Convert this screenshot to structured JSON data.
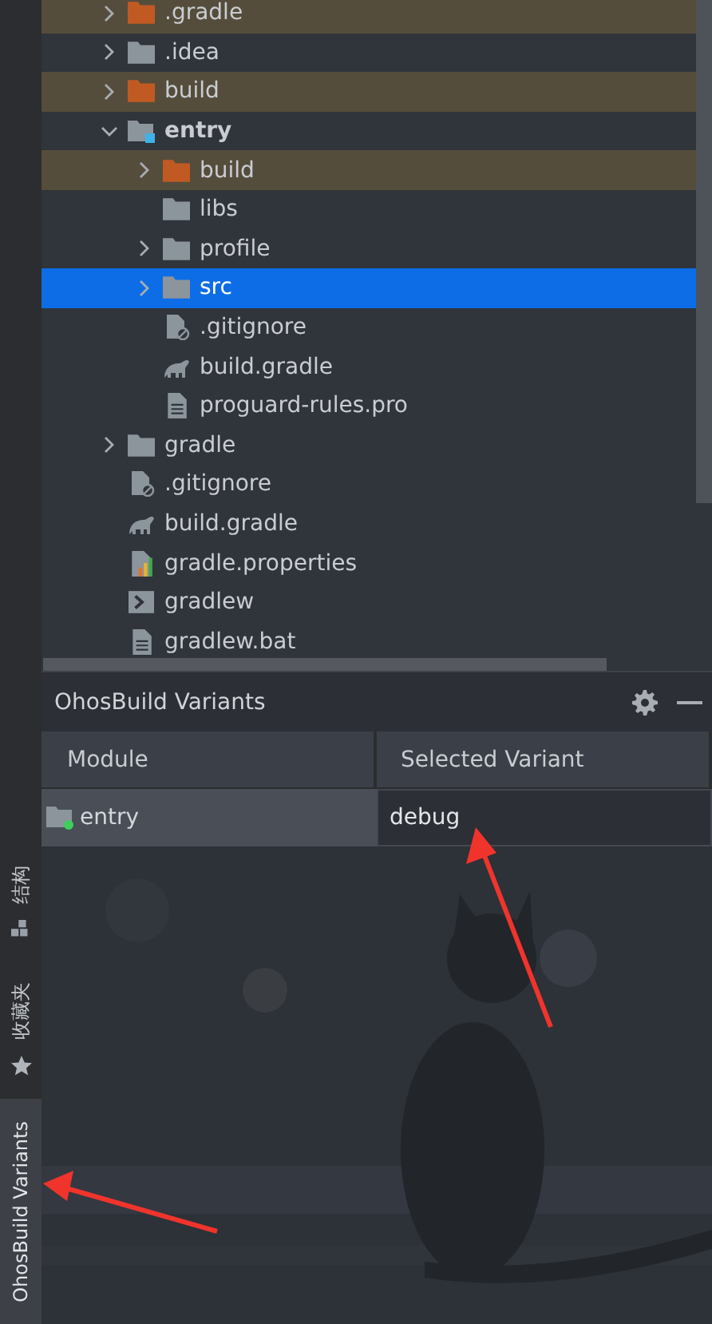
{
  "project_tree": {
    "items": [
      {
        "label": ".gradle",
        "kind": "folder",
        "excluded": true,
        "expanded": false,
        "selected": false
      },
      {
        "label": ".idea",
        "kind": "folder",
        "excluded": false,
        "expanded": false,
        "selected": false
      },
      {
        "label": "build",
        "kind": "folder",
        "excluded": true,
        "expanded": false,
        "selected": false
      },
      {
        "label": "entry",
        "kind": "module",
        "excluded": false,
        "expanded": true,
        "selected": false,
        "children": [
          {
            "label": "build",
            "kind": "folder",
            "excluded": true,
            "expanded": false,
            "selected": false
          },
          {
            "label": "libs",
            "kind": "folder",
            "excluded": false,
            "selected": false
          },
          {
            "label": "profile",
            "kind": "folder",
            "excluded": false,
            "expanded": false,
            "selected": false
          },
          {
            "label": "src",
            "kind": "folder",
            "excluded": false,
            "expanded": false,
            "selected": true
          },
          {
            "label": ".gitignore",
            "kind": "ignore",
            "excluded": false,
            "selected": false
          },
          {
            "label": "build.gradle",
            "kind": "gradle",
            "excluded": false,
            "selected": false
          },
          {
            "label": "proguard-rules.pro",
            "kind": "text",
            "excluded": false,
            "selected": false
          }
        ]
      },
      {
        "label": "gradle",
        "kind": "folder",
        "excluded": false,
        "expanded": false,
        "selected": false
      },
      {
        "label": ".gitignore",
        "kind": "ignore",
        "excluded": false,
        "selected": false
      },
      {
        "label": "build.gradle",
        "kind": "gradle",
        "excluded": false,
        "selected": false
      },
      {
        "label": "gradle.properties",
        "kind": "properties",
        "excluded": false,
        "selected": false
      },
      {
        "label": "gradlew",
        "kind": "script",
        "excluded": false,
        "selected": false
      },
      {
        "label": "gradlew.bat",
        "kind": "text",
        "excluded": false,
        "selected": false
      }
    ]
  },
  "tool_tabs": [
    {
      "label": "结构",
      "selected": false
    },
    {
      "label": "收藏夹",
      "selected": false
    },
    {
      "label": "OhosBuild Variants",
      "selected": true
    }
  ],
  "variants_panel": {
    "title": "OhosBuild Variants",
    "columns": [
      "Module",
      "Selected Variant"
    ],
    "rows": [
      {
        "module": "entry",
        "variant": "debug"
      }
    ]
  },
  "callouts": [
    {
      "kind": "arrow"
    },
    {
      "kind": "arrow"
    }
  ]
}
